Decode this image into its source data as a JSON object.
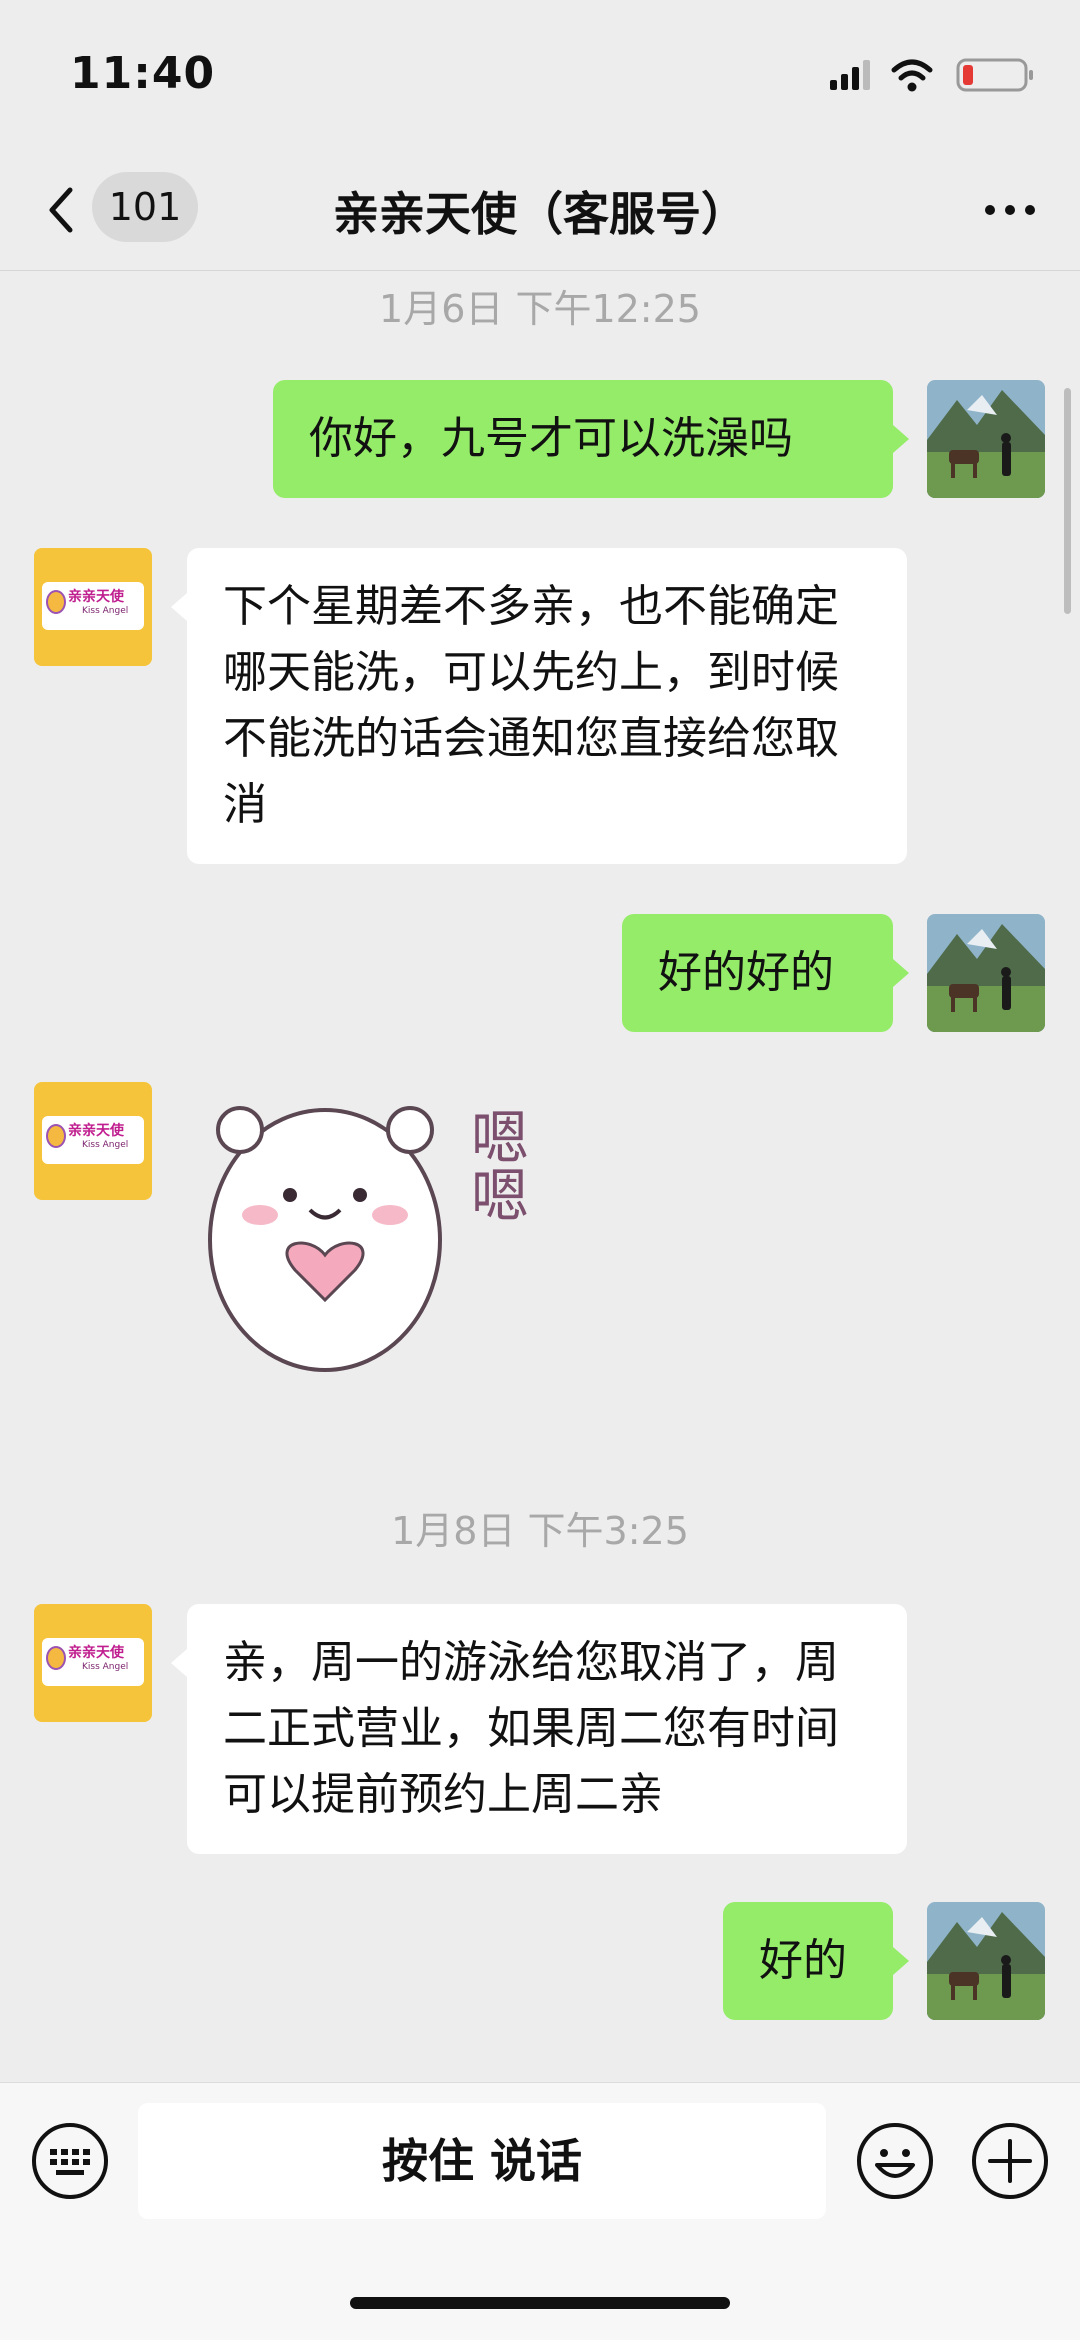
{
  "status_bar": {
    "time": "11:40"
  },
  "nav": {
    "unread_count": "101",
    "title": "亲亲天使（客服号）"
  },
  "brand": {
    "name": "亲亲天使",
    "sub": "Kiss Angel"
  },
  "messages": [
    {
      "type": "timestamp",
      "text": "1月6日 下午12:25"
    },
    {
      "type": "text",
      "side": "right",
      "text": "你好，九号才可以洗澡吗"
    },
    {
      "type": "text",
      "side": "left",
      "text": "下个星期差不多亲，也不能确定哪天能洗，可以先约上，到时候不能洗的话会通知您直接给您取消"
    },
    {
      "type": "text",
      "side": "right",
      "text": "好的好的"
    },
    {
      "type": "sticker",
      "side": "left",
      "text": "嗯嗯"
    },
    {
      "type": "timestamp",
      "text": "1月8日 下午3:25"
    },
    {
      "type": "text",
      "side": "left",
      "text": "亲，周一的游泳给您取消了，周二正式营业，如果周二您有时间可以提前预约上周二亲"
    },
    {
      "type": "text",
      "side": "right",
      "text": "好的"
    }
  ],
  "input": {
    "hold_to_talk": "按住 说话"
  },
  "colors": {
    "bubble_self": "#95ec69",
    "bubble_other": "#ffffff",
    "background": "#ededed",
    "avatar_brand": "#f5c43a"
  },
  "icons": [
    "back-icon",
    "more-icon",
    "keyboard-icon",
    "emoji-icon",
    "plus-icon",
    "signal-icon",
    "wifi-icon",
    "battery-icon"
  ]
}
